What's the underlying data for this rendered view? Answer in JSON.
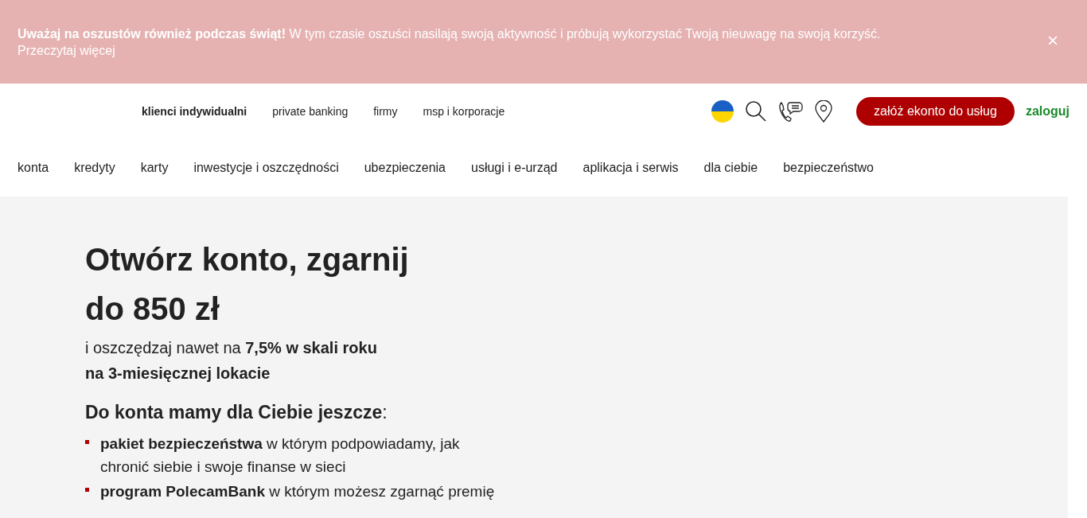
{
  "alert": {
    "text": "**Uważaj na oszustów również podczas świąt!** W tym czasie oszuści nasilają swoją aktywność i próbują wykorzystać Twoją nieuwagę na swoją korzyść.",
    "link": "Przeczytaj więcej",
    "close": "×"
  },
  "segments": [
    {
      "label": "klienci indywidualni",
      "selected": true
    },
    {
      "label": "private banking",
      "selected": false
    },
    {
      "label": "firmy",
      "selected": false
    },
    {
      "label": "msp i korporacje",
      "selected": false
    }
  ],
  "cta": "załóż ekonto do usług",
  "login": "zaloguj",
  "menu": [
    "konta",
    "kredyty",
    "karty",
    "inwestycje i oszczędności",
    "ubezpieczenia",
    "usługi i e-urząd",
    "aplikacja i serwis",
    "dla ciebie",
    "bezpieczeństwo"
  ],
  "hero": {
    "title": "Otwórz konto, zgarnij do 850 zł",
    "subtitle": "i oszczędzaj nawet na **7,5% w skali roku na 3-miesięcznej lokacie**",
    "extras_heading": "**Do konta mamy dla Ciebie jeszcze**:",
    "bullets": [
      "**pakiet bezpieczeństwa** w którym podpowiadamy, jak chronić siebie i swoje finanse w sieci",
      "**program PolecamBank** w którym możesz zgarnąć premię"
    ]
  }
}
